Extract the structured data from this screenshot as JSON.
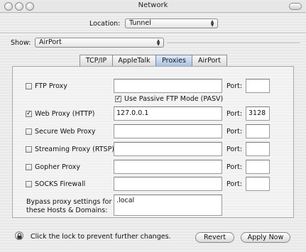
{
  "window": {
    "title": "Network"
  },
  "location": {
    "label": "Location:",
    "value": "Tunnel"
  },
  "show": {
    "label": "Show:",
    "value": "AirPort"
  },
  "tabs": [
    {
      "label": "TCP/IP",
      "selected": false
    },
    {
      "label": "AppleTalk",
      "selected": false
    },
    {
      "label": "Proxies",
      "selected": true
    },
    {
      "label": "AirPort",
      "selected": false
    }
  ],
  "proxies": {
    "port_label": "Port:",
    "ftp": {
      "label": "FTP Proxy",
      "checked": false,
      "server": "",
      "port": ""
    },
    "passive_ftp": {
      "label": "Use Passive FTP Mode (PASV)",
      "checked": true
    },
    "web": {
      "label": "Web Proxy (HTTP)",
      "checked": true,
      "server": "127.0.0.1",
      "port": "3128"
    },
    "secure_web": {
      "label": "Secure Web Proxy",
      "checked": false,
      "server": "",
      "port": ""
    },
    "streaming": {
      "label": "Streaming Proxy (RTSP)",
      "checked": false,
      "server": "",
      "port": ""
    },
    "gopher": {
      "label": "Gopher Proxy",
      "checked": false,
      "server": "",
      "port": ""
    },
    "socks": {
      "label": "SOCKS Firewall",
      "checked": false,
      "server": "",
      "port": ""
    },
    "bypass": {
      "label_line1": "Bypass proxy settings for",
      "label_line2": "these Hosts & Domains:",
      "value": ".local"
    }
  },
  "footer": {
    "lock_text": "Click the lock to prevent further changes.",
    "revert_label": "Revert",
    "apply_label": "Apply Now"
  },
  "icons": {
    "lock": "lock-icon",
    "popup_arrows": "updown-arrows-icon"
  },
  "colors": {
    "selected_tab": "#a9c1e4",
    "window_bg": "#ececec"
  }
}
